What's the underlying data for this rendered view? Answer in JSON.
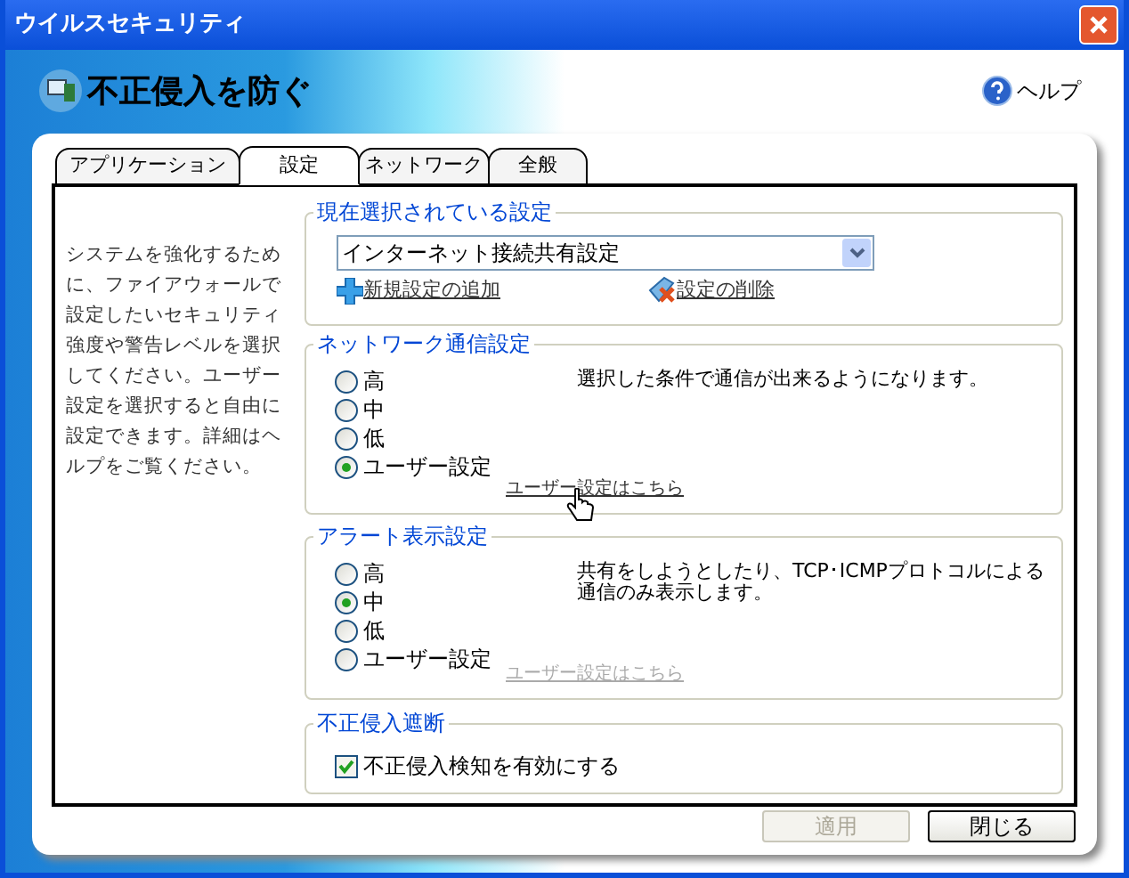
{
  "window": {
    "title": "ウイルスセキュリティ"
  },
  "header": {
    "title": "不正侵入を防ぐ",
    "help": "ヘルプ"
  },
  "tabs": [
    {
      "label": "アプリケーション",
      "selected": false
    },
    {
      "label": "設定",
      "selected": true
    },
    {
      "label": "ネットワーク",
      "selected": false
    },
    {
      "label": "全般",
      "selected": false
    }
  ],
  "description": "システムを強化するために、ファイアウォールで設定したいセキュリティ強度や警告レベルを選択してください。ユーザー設定を選択すると自由に設定できます。詳細はヘルプをご覧ください。",
  "current_setting": {
    "title": "現在選択されている設定",
    "dropdown": {
      "value": "インターネット接続共有設定"
    },
    "add_link": "新規設定の追加",
    "delete_link": "設定の削除"
  },
  "groups": [
    {
      "title": "ネットワーク通信設定",
      "options": [
        {
          "label": "高",
          "selected": false
        },
        {
          "label": "中",
          "selected": false
        },
        {
          "label": "低",
          "selected": false
        },
        {
          "label": "ユーザー設定",
          "selected": true
        }
      ],
      "message": "選択した条件で通信が出来るようになります。",
      "custom_link": {
        "label": "ユーザー設定はこちら",
        "disabled": false
      }
    },
    {
      "title": "アラート表示設定",
      "options": [
        {
          "label": "高",
          "selected": false
        },
        {
          "label": "中",
          "selected": true
        },
        {
          "label": "低",
          "selected": false
        },
        {
          "label": "ユーザー設定",
          "selected": false
        }
      ],
      "message": "共有をしようとしたり、TCP･ICMPプロトコルによる通信のみ表示します。",
      "custom_link": {
        "label": "ユーザー設定はこちら",
        "disabled": true
      }
    }
  ],
  "intrusion": {
    "title": "不正侵入遮断",
    "checkbox": {
      "label": "不正侵入検知を有効にする",
      "checked": true
    }
  },
  "buttons": [
    {
      "label": "適用",
      "disabled": true
    },
    {
      "label": "閉じる",
      "disabled": false
    }
  ]
}
